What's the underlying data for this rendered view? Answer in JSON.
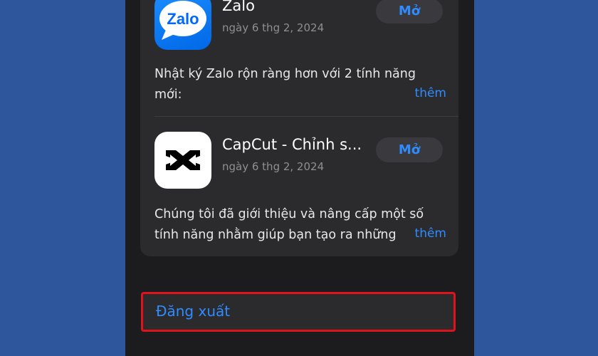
{
  "updates": [
    {
      "name": "Zalo",
      "date": "ngày 6 thg 2, 2024",
      "button": "Mở",
      "icon": "zalo-app-icon",
      "icon_text": "Zalo",
      "notes": [
        "Nhật ký Zalo rộn ràng hơn với 2 tính năng",
        "mới:"
      ],
      "more": "thêm"
    },
    {
      "name": "CapCut - Chỉnh s...",
      "date": "ngày 6 thg 2, 2024",
      "button": "Mở",
      "icon": "capcut-app-icon",
      "notes": [
        "Chúng tôi đã giới thiệu và nâng cấp một số",
        "tính năng nhằm giúp bạn tạo ra những"
      ],
      "more": "thêm"
    }
  ],
  "logout": {
    "label": "Đăng xuất",
    "highlight_color": "#e0121b"
  },
  "colors": {
    "accent": "#2f8cff",
    "background": "#2e569d",
    "panel": "#1c1c1e",
    "card": "#2b2b2e"
  }
}
